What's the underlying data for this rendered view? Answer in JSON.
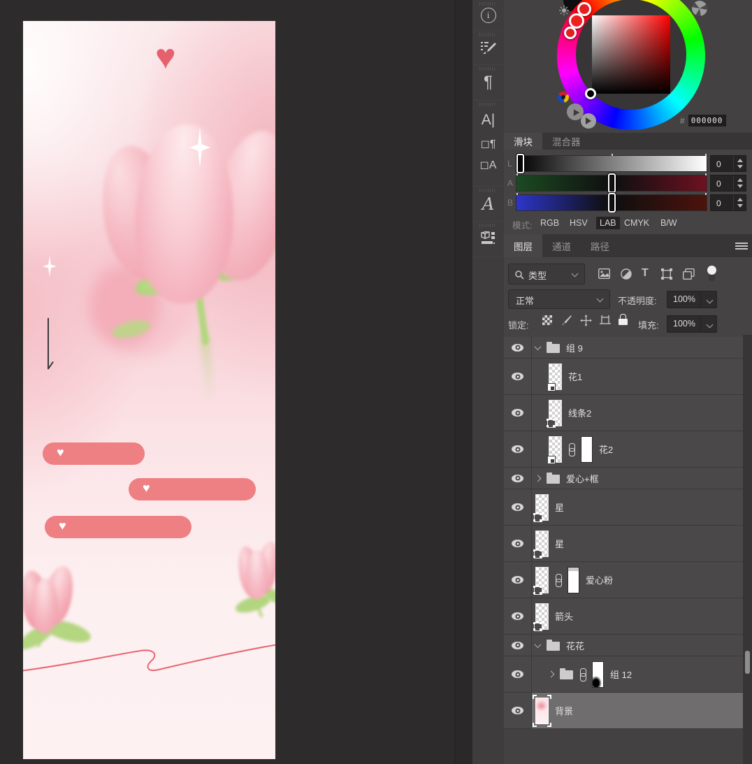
{
  "artwork": {
    "background_pink": "#f8d3d8",
    "tulip_pink": "#f2a5b0",
    "leaf_green": "#abd378",
    "pill_salmon": "#ee7f82",
    "heart_red": "#e6616e",
    "line_red": "#e96671",
    "heart_glyph": "♥"
  },
  "toolbar": {
    "icons": [
      "info",
      "brush-settings",
      "paragraph",
      "text-cursor",
      "paragraph-styles",
      "character-styles",
      "glyphs",
      "3d-properties"
    ]
  },
  "color_picker": {
    "hex_label": "#",
    "hex_value": "000000"
  },
  "sliders_panel": {
    "tabs": [
      "滑块",
      "混合器"
    ],
    "active_tab": "滑块",
    "sliders": [
      {
        "label": "L",
        "value": "0"
      },
      {
        "label": "A",
        "value": "0"
      },
      {
        "label": "B",
        "value": "0"
      }
    ],
    "mode_label": "模式:",
    "modes": [
      "RGB",
      "HSV",
      "LAB",
      "CMYK",
      "B/W"
    ],
    "active_mode": "LAB"
  },
  "layers_panel": {
    "tabs": [
      "图层",
      "通道",
      "路径"
    ],
    "active_tab": "图层",
    "filter_value": "类型",
    "blend_mode": "正常",
    "opacity_label": "不透明度:",
    "opacity_value": "100%",
    "lock_label": "锁定:",
    "fill_label": "填充:",
    "fill_value": "100%",
    "rows": [
      {
        "kind": "group",
        "name": "组 9",
        "expanded": true,
        "indent": 0
      },
      {
        "kind": "layer",
        "name": "花1",
        "indent": 1,
        "badge": "smart-object"
      },
      {
        "kind": "layer",
        "name": "线条2",
        "indent": 1,
        "badge": "shape"
      },
      {
        "kind": "layer",
        "name": "花2",
        "indent": 1,
        "badge": "smart-object",
        "mask": "white"
      },
      {
        "kind": "group",
        "name": "爱心+框",
        "expanded": false,
        "indent": 0
      },
      {
        "kind": "layer",
        "name": "星",
        "indent": 0,
        "badge": "shape"
      },
      {
        "kind": "layer",
        "name": "星",
        "indent": 0,
        "badge": "shape"
      },
      {
        "kind": "layer",
        "name": "爱心粉",
        "indent": 0,
        "badge": "shape",
        "mask": "top-gray"
      },
      {
        "kind": "layer",
        "name": "箭头",
        "indent": 0,
        "badge": "shape"
      },
      {
        "kind": "group",
        "name": "花花",
        "expanded": true,
        "indent": 0
      },
      {
        "kind": "group",
        "name": "组 12",
        "expanded": false,
        "indent": 1,
        "mask": "black-blob"
      },
      {
        "kind": "layer",
        "name": "背景",
        "indent": 0,
        "thumb": "background-art",
        "selected": true
      }
    ]
  }
}
